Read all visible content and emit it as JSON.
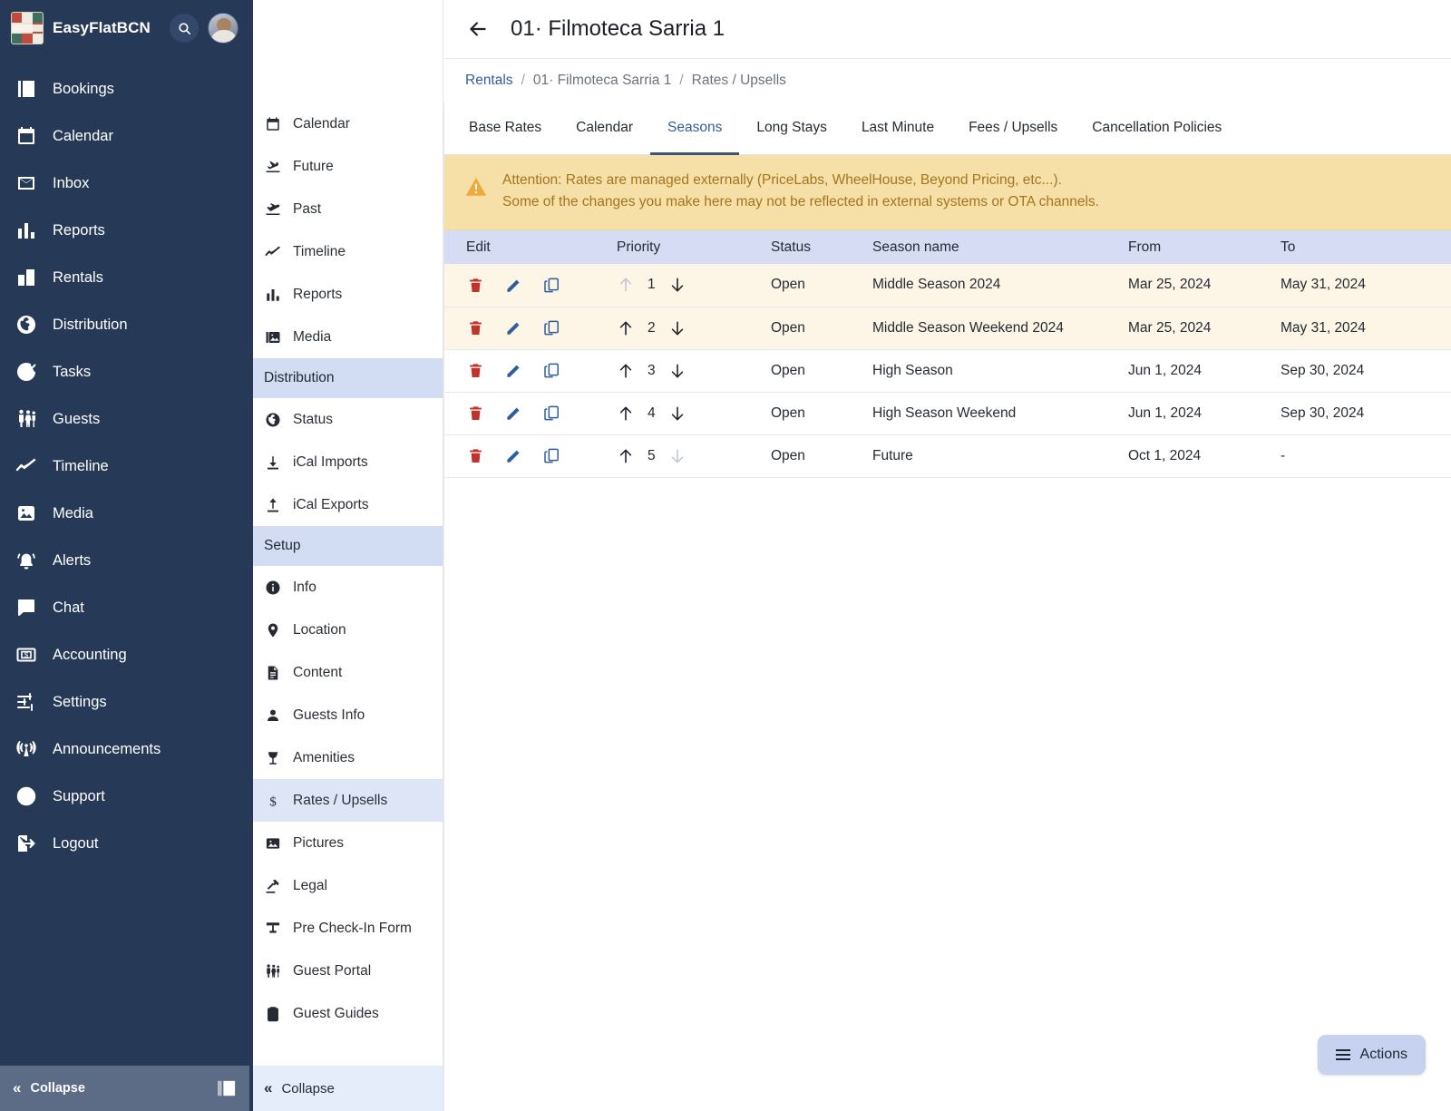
{
  "sidebar": {
    "brand": "EasyFlatBCN",
    "search_icon": "search-icon",
    "avatar_alt": "user-avatar",
    "items": [
      {
        "label": "Bookings",
        "icon": "bookings-icon"
      },
      {
        "label": "Calendar",
        "icon": "calendar-icon"
      },
      {
        "label": "Inbox",
        "icon": "inbox-icon"
      },
      {
        "label": "Reports",
        "icon": "reports-icon"
      },
      {
        "label": "Rentals",
        "icon": "rentals-icon"
      },
      {
        "label": "Distribution",
        "icon": "globe-icon"
      },
      {
        "label": "Tasks",
        "icon": "check-circle-icon"
      },
      {
        "label": "Guests",
        "icon": "guests-icon"
      },
      {
        "label": "Timeline",
        "icon": "timeline-icon"
      },
      {
        "label": "Media",
        "icon": "media-icon"
      },
      {
        "label": "Alerts",
        "icon": "bell-icon"
      },
      {
        "label": "Chat",
        "icon": "chat-icon"
      },
      {
        "label": "Accounting",
        "icon": "money-icon"
      },
      {
        "label": "Settings",
        "icon": "sliders-icon"
      },
      {
        "label": "Announcements",
        "icon": "broadcast-icon"
      },
      {
        "label": "Support",
        "icon": "question-circle-icon"
      },
      {
        "label": "Logout",
        "icon": "logout-icon"
      }
    ],
    "collapse_label": "Collapse"
  },
  "subnav": {
    "items": [
      {
        "type": "item",
        "label": "Calendar",
        "icon": "calendar-icon"
      },
      {
        "type": "item",
        "label": "Future",
        "icon": "plane-arrival-icon"
      },
      {
        "type": "item",
        "label": "Past",
        "icon": "plane-departure-icon"
      },
      {
        "type": "item",
        "label": "Timeline",
        "icon": "timeline-icon"
      },
      {
        "type": "item",
        "label": "Reports",
        "icon": "reports-icon"
      },
      {
        "type": "item",
        "label": "Media",
        "icon": "media-icon"
      },
      {
        "type": "group",
        "label": "Distribution"
      },
      {
        "type": "item",
        "label": "Status",
        "icon": "globe-icon"
      },
      {
        "type": "item",
        "label": "iCal Imports",
        "icon": "download-icon"
      },
      {
        "type": "item",
        "label": "iCal Exports",
        "icon": "upload-icon"
      },
      {
        "type": "group",
        "label": "Setup"
      },
      {
        "type": "item",
        "label": "Info",
        "icon": "info-icon"
      },
      {
        "type": "item",
        "label": "Location",
        "icon": "map-pin-icon"
      },
      {
        "type": "item",
        "label": "Content",
        "icon": "document-icon"
      },
      {
        "type": "item",
        "label": "Guests Info",
        "icon": "person-icon"
      },
      {
        "type": "item",
        "label": "Amenities",
        "icon": "glass-icon"
      },
      {
        "type": "item",
        "label": "Rates / Upsells",
        "icon": "dollar-icon",
        "active": true
      },
      {
        "type": "item",
        "label": "Pictures",
        "icon": "picture-icon"
      },
      {
        "type": "item",
        "label": "Legal",
        "icon": "gavel-icon"
      },
      {
        "type": "item",
        "label": "Pre Check-In Form",
        "icon": "form-icon"
      },
      {
        "type": "item",
        "label": "Guest Portal",
        "icon": "guests-icon"
      },
      {
        "type": "item",
        "label": "Guest Guides",
        "icon": "clipboard-icon"
      }
    ],
    "collapse_label": "Collapse"
  },
  "header": {
    "back_icon": "arrow-left-icon",
    "title": "01· Filmoteca Sarria 1"
  },
  "breadcrumb": {
    "root": "Rentals",
    "sep": "/",
    "middle": "01· Filmoteca Sarria 1",
    "current": "Rates / Upsells"
  },
  "tabs": [
    {
      "label": "Base Rates",
      "active": false
    },
    {
      "label": "Calendar",
      "active": false
    },
    {
      "label": "Seasons",
      "active": true
    },
    {
      "label": "Long Stays",
      "active": false
    },
    {
      "label": "Last Minute",
      "active": false
    },
    {
      "label": "Fees / Upsells",
      "active": false
    },
    {
      "label": "Cancellation Policies",
      "active": false
    }
  ],
  "banner": {
    "icon": "warning-triangle-icon",
    "line1": "Attention: Rates are managed externally (PriceLabs, WheelHouse, Beyond Pricing, etc...).",
    "line2": "Some of the changes you make here may not be reflected in external systems or OTA channels."
  },
  "table": {
    "columns": [
      "Edit",
      "Priority",
      "Status",
      "Season name",
      "From",
      "To"
    ],
    "rows": [
      {
        "priority": "1",
        "status": "Open",
        "name": "Middle Season 2024",
        "from": "Mar 25, 2024",
        "to": "May 31, 2024",
        "tinted": true,
        "up_enabled": false,
        "down_enabled": true
      },
      {
        "priority": "2",
        "status": "Open",
        "name": "Middle Season Weekend 2024",
        "from": "Mar 25, 2024",
        "to": "May 31, 2024",
        "tinted": true,
        "up_enabled": true,
        "down_enabled": true
      },
      {
        "priority": "3",
        "status": "Open",
        "name": "High Season",
        "from": "Jun 1, 2024",
        "to": "Sep 30, 2024",
        "tinted": false,
        "up_enabled": true,
        "down_enabled": true
      },
      {
        "priority": "4",
        "status": "Open",
        "name": "High Season Weekend",
        "from": "Jun 1, 2024",
        "to": "Sep 30, 2024",
        "tinted": false,
        "up_enabled": true,
        "down_enabled": true
      },
      {
        "priority": "5",
        "status": "Open",
        "name": "Future",
        "from": "Oct 1, 2024",
        "to": "-",
        "tinted": false,
        "up_enabled": true,
        "down_enabled": false
      }
    ],
    "row_icons": [
      "delete-icon",
      "edit-icon",
      "duplicate-icon"
    ]
  },
  "actions_button": {
    "label": "Actions",
    "icon": "hamburger-icon"
  },
  "colors": {
    "sidebar_bg": "#263a58",
    "banner_bg": "#f7e0a8",
    "banner_text": "#a2761e",
    "table_header_bg": "#d5dcf3",
    "row_tint": "#fdf6e6",
    "accent_link": "#2f5e9e",
    "delete_icon": "#c0332a",
    "edit_icon": "#2f5e9e",
    "actions_bg": "#c6d2ef"
  }
}
